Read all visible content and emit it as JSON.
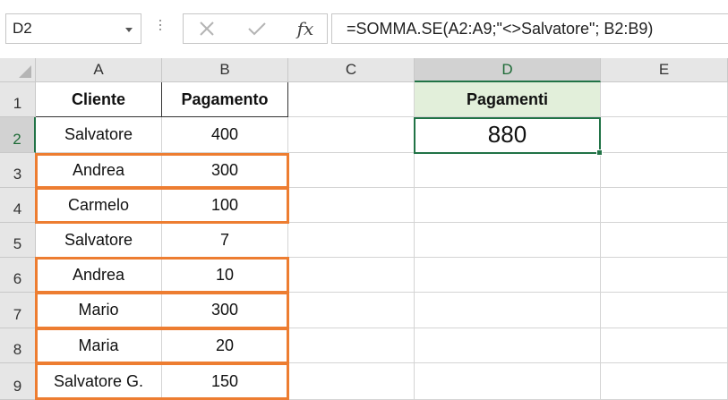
{
  "name_box": {
    "value": "D2"
  },
  "formula_bar": {
    "cancel_icon": "x-icon",
    "enter_icon": "check-icon",
    "fx_label": "fx",
    "formula": "=SOMMA.SE(A2:A9;\"<>Salvatore\"; B2:B9)"
  },
  "columns": [
    "A",
    "B",
    "C",
    "D",
    "E"
  ],
  "rows": [
    "1",
    "2",
    "3",
    "4",
    "5",
    "6",
    "7",
    "8",
    "9"
  ],
  "table": {
    "headers": {
      "cliente": "Cliente",
      "pagamento": "Pagamento"
    },
    "records": [
      {
        "cliente": "Salvatore",
        "pagamento": "400"
      },
      {
        "cliente": "Andrea",
        "pagamento": "300"
      },
      {
        "cliente": "Carmelo",
        "pagamento": "100"
      },
      {
        "cliente": "Salvatore",
        "pagamento": "7"
      },
      {
        "cliente": "Andrea",
        "pagamento": "10"
      },
      {
        "cliente": "Mario",
        "pagamento": "300"
      },
      {
        "cliente": "Maria",
        "pagamento": "20"
      },
      {
        "cliente": "Salvatore G.",
        "pagamento": "150"
      }
    ]
  },
  "result": {
    "header": "Pagamenti",
    "value": "880"
  },
  "selection": {
    "active_cell": "D2",
    "highlight_color": "#217346"
  },
  "highlight_box_color": "#ed7d31",
  "header_fill_color": "#e2efda"
}
